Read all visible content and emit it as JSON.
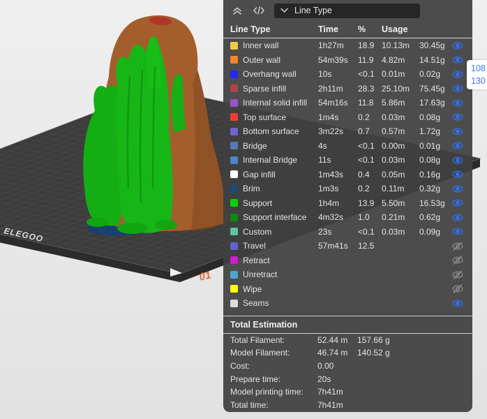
{
  "viewport": {
    "plate_brand": "ELEGOO",
    "plate_corner_label": "01"
  },
  "layer_badge": {
    "top": "108",
    "bottom": "130"
  },
  "panel": {
    "toolbar": {
      "dropdown_label": "Line Type",
      "collapse_icon": "double-chevron-up",
      "gcode_icon": "code-brackets"
    },
    "table": {
      "headers": {
        "line_type": "Line Type",
        "time": "Time",
        "percent": "%",
        "usage": "Usage"
      },
      "rows": [
        {
          "label": "Inner wall",
          "color": "#F2CB46",
          "time": "1h27m",
          "percent": "18.9",
          "usage_m": "10.13m",
          "usage_g": "30.45g",
          "visible": true
        },
        {
          "label": "Outer wall",
          "color": "#F0852B",
          "time": "54m39s",
          "percent": "11.9",
          "usage_m": "4.82m",
          "usage_g": "14.51g",
          "visible": true
        },
        {
          "label": "Overhang wall",
          "color": "#2626F2",
          "time": "10s",
          "percent": "<0.1",
          "usage_m": "0.01m",
          "usage_g": "0.02g",
          "visible": true
        },
        {
          "label": "Sparse infill",
          "color": "#AC4545",
          "time": "2h11m",
          "percent": "28.3",
          "usage_m": "25.10m",
          "usage_g": "75.45g",
          "visible": true
        },
        {
          "label": "Internal solid infill",
          "color": "#9456C8",
          "time": "54m16s",
          "percent": "11.8",
          "usage_m": "5.86m",
          "usage_g": "17.63g",
          "visible": true
        },
        {
          "label": "Top surface",
          "color": "#F03C34",
          "time": "1m4s",
          "percent": "0.2",
          "usage_m": "0.03m",
          "usage_g": "0.08g",
          "visible": true
        },
        {
          "label": "Bottom surface",
          "color": "#6F63D1",
          "time": "3m22s",
          "percent": "0.7",
          "usage_m": "0.57m",
          "usage_g": "1.72g",
          "visible": true
        },
        {
          "label": "Bridge",
          "color": "#5A75B8",
          "time": "4s",
          "percent": "<0.1",
          "usage_m": "0.00m",
          "usage_g": "0.01g",
          "visible": true
        },
        {
          "label": "Internal Bridge",
          "color": "#4F83C3",
          "time": "11s",
          "percent": "<0.1",
          "usage_m": "0.03m",
          "usage_g": "0.08g",
          "visible": true
        },
        {
          "label": "Gap infill",
          "color": "#FFFFFF",
          "time": "1m43s",
          "percent": "0.4",
          "usage_m": "0.05m",
          "usage_g": "0.16g",
          "visible": true
        },
        {
          "label": "Brim",
          "color": "#1C4A74",
          "time": "1m3s",
          "percent": "0.2",
          "usage_m": "0.11m",
          "usage_g": "0.32g",
          "visible": true
        },
        {
          "label": "Support",
          "color": "#0BCE0B",
          "time": "1h4m",
          "percent": "13.9",
          "usage_m": "5.50m",
          "usage_g": "16.53g",
          "visible": true
        },
        {
          "label": "Support interface",
          "color": "#0E8A0E",
          "time": "4m32s",
          "percent": "1.0",
          "usage_m": "0.21m",
          "usage_g": "0.62g",
          "visible": true
        },
        {
          "label": "Custom",
          "color": "#62C29F",
          "time": "23s",
          "percent": "<0.1",
          "usage_m": "0.03m",
          "usage_g": "0.09g",
          "visible": true
        },
        {
          "label": "Travel",
          "color": "#6262CE",
          "time": "57m41s",
          "percent": "12.5",
          "usage_m": "",
          "usage_g": "",
          "visible": false
        },
        {
          "label": "Retract",
          "color": "#CC1ECC",
          "time": "",
          "percent": "",
          "usage_m": "",
          "usage_g": "",
          "visible": false
        },
        {
          "label": "Unretract",
          "color": "#4BA6CC",
          "time": "",
          "percent": "",
          "usage_m": "",
          "usage_g": "",
          "visible": false
        },
        {
          "label": "Wipe",
          "color": "#FDFD10",
          "time": "",
          "percent": "",
          "usage_m": "",
          "usage_g": "",
          "visible": false
        },
        {
          "label": "Seams",
          "color": "#DCDCDC",
          "time": "",
          "percent": "",
          "usage_m": "",
          "usage_g": "",
          "visible": true
        }
      ]
    },
    "totals": {
      "title": "Total Estimation",
      "rows": [
        {
          "label": "Total Filament:",
          "value1": "52.44 m",
          "value2": "157.66 g"
        },
        {
          "label": "Model Filament:",
          "value1": "46.74 m",
          "value2": "140.52 g"
        },
        {
          "label": "Cost:",
          "value1": "0.00",
          "value2": ""
        },
        {
          "label": "Prepare time:",
          "value1": "20s",
          "value2": ""
        },
        {
          "label": "Model printing time:",
          "value1": "7h41m",
          "value2": ""
        },
        {
          "label": "Total time:",
          "value1": "7h41m",
          "value2": ""
        }
      ]
    }
  },
  "colors": {
    "panel_bg": "#424242",
    "dropdown_bg": "#262626",
    "eye_visible": "#2E6FF0",
    "eye_hidden": "#8F8F8F",
    "badge_text": "#3A7BF5",
    "viewport_bg": "#E8E8E8",
    "plate_surface": "#3C3C3C",
    "plate_grid_line": "#505050",
    "model_body": "#A35E2B",
    "model_support": "#16B616",
    "plate_corner_label_color": "#E06A35"
  }
}
